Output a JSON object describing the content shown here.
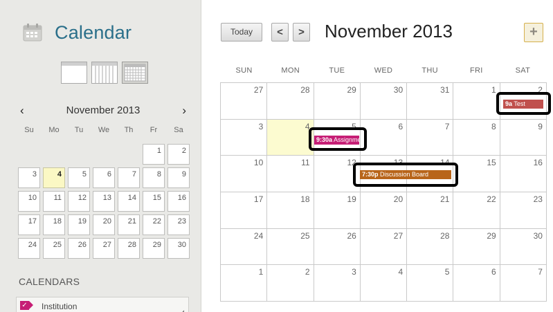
{
  "app": {
    "title": "Calendar"
  },
  "sidebar": {
    "mini_month_label": "November 2013",
    "prev_symbol": "‹",
    "next_symbol": "›",
    "weekdays": [
      "Su",
      "Mo",
      "Tu",
      "We",
      "Th",
      "Fr",
      "Sa"
    ],
    "weeks": [
      [
        "",
        "",
        "",
        "",
        "",
        "1",
        "2"
      ],
      [
        "3",
        "4",
        "5",
        "6",
        "7",
        "8",
        "9"
      ],
      [
        "10",
        "11",
        "12",
        "13",
        "14",
        "15",
        "16"
      ],
      [
        "17",
        "18",
        "19",
        "20",
        "21",
        "22",
        "23"
      ],
      [
        "24",
        "25",
        "26",
        "27",
        "28",
        "29",
        "30"
      ]
    ],
    "today": "4",
    "calendars_heading": "CALENDARS",
    "calendars": [
      {
        "label": "Institution",
        "checked": true,
        "color": "#c61e75"
      }
    ]
  },
  "toolbar": {
    "today_label": "Today",
    "prev_symbol": "<",
    "next_symbol": ">",
    "month_title": "November 2013",
    "add_symbol": "+"
  },
  "month": {
    "weekdays": [
      "SUN",
      "MON",
      "TUE",
      "WED",
      "THU",
      "FRI",
      "SAT"
    ],
    "cells": [
      "27",
      "28",
      "29",
      "30",
      "31",
      "1",
      "2",
      "3",
      "4",
      "5",
      "6",
      "7",
      "8",
      "9",
      "10",
      "11",
      "12",
      "13",
      "14",
      "15",
      "16",
      "17",
      "18",
      "19",
      "20",
      "21",
      "22",
      "23",
      "24",
      "25",
      "26",
      "27",
      "28",
      "29",
      "30",
      "1",
      "2",
      "3",
      "4",
      "5",
      "6",
      "7"
    ],
    "today_index": 8,
    "events": [
      {
        "time": "9a",
        "title": "Test",
        "color": "#c0504d"
      },
      {
        "time": "9:30a",
        "title": "Assignment",
        "color": "#c61e75"
      },
      {
        "time": "7:30p",
        "title": "Discussion Board",
        "color": "#b8651a"
      }
    ]
  }
}
